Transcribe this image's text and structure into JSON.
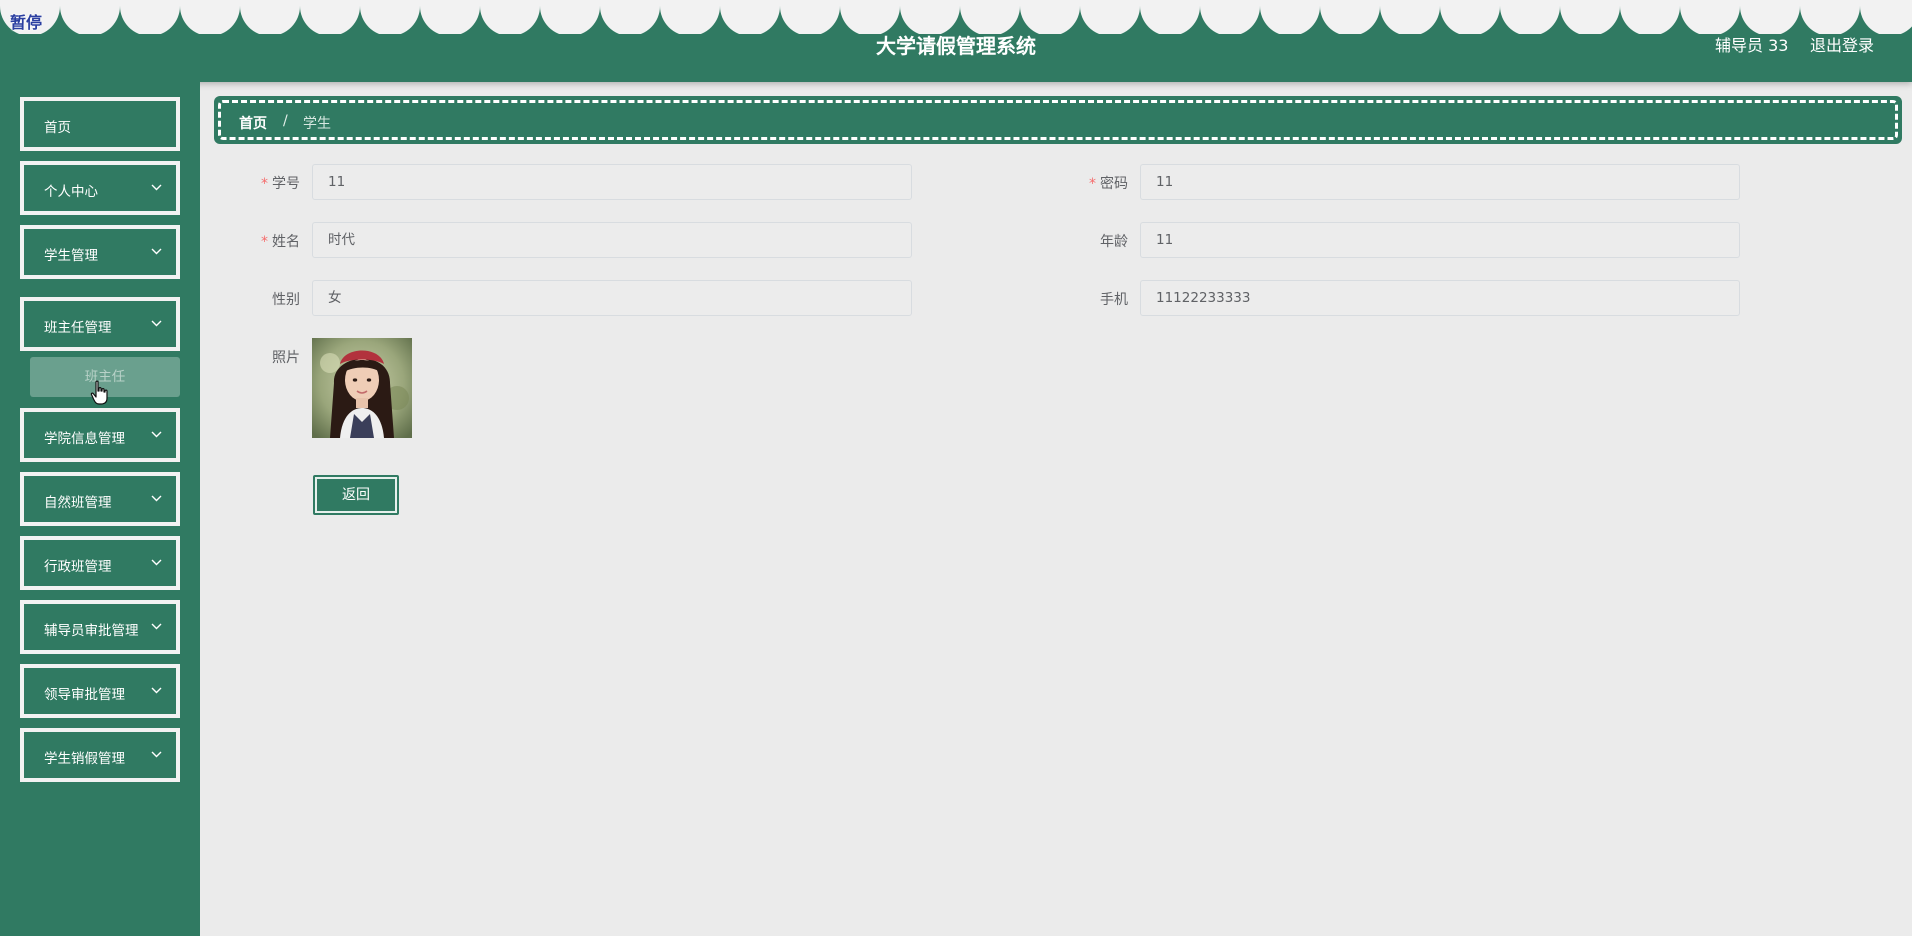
{
  "header": {
    "pause_tag": "暂停",
    "title": "大学请假管理系统",
    "user": "辅导员 33",
    "logout": "退出登录"
  },
  "sidebar": {
    "items": [
      {
        "label": "首页",
        "has_arrow": false
      },
      {
        "label": "个人中心",
        "has_arrow": true
      },
      {
        "label": "学生管理",
        "has_arrow": true
      },
      {
        "label": "班主任管理",
        "has_arrow": true
      },
      {
        "label": "学院信息管理",
        "has_arrow": true
      },
      {
        "label": "自然班管理",
        "has_arrow": true
      },
      {
        "label": "行政班管理",
        "has_arrow": true
      },
      {
        "label": "辅导员审批管理",
        "has_arrow": true
      },
      {
        "label": "领导审批管理",
        "has_arrow": true
      },
      {
        "label": "学生销假管理",
        "has_arrow": true
      }
    ],
    "submenu_label": "班主任"
  },
  "breadcrumb": {
    "home": "首页",
    "separator": "/",
    "current": "学生"
  },
  "form": {
    "student_id": {
      "label": "学号",
      "value": "11",
      "required": true
    },
    "password": {
      "label": "密码",
      "value": "11",
      "required": true
    },
    "name": {
      "label": "姓名",
      "value": "时代",
      "required": true
    },
    "age": {
      "label": "年龄",
      "value": "11",
      "required": false
    },
    "gender": {
      "label": "性别",
      "value": "女",
      "required": false
    },
    "phone": {
      "label": "手机",
      "value": "11122233333",
      "required": false
    },
    "photo": {
      "label": "照片"
    },
    "back_button": "返回"
  },
  "colors": {
    "primary": "#307a62",
    "background": "#ebebeb",
    "required_mark": "#f56c6c"
  }
}
